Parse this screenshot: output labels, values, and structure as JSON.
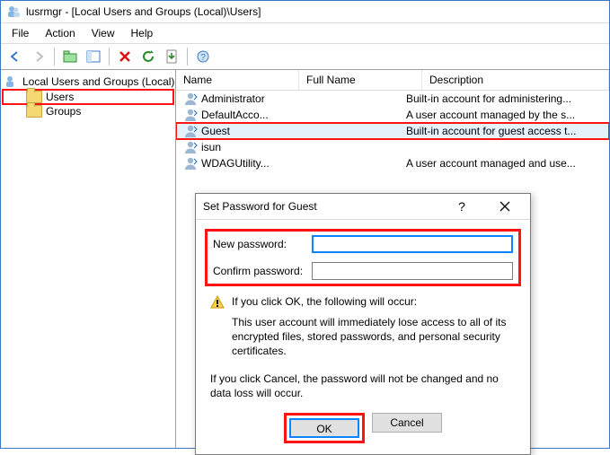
{
  "window": {
    "title": "lusrmgr - [Local Users and Groups (Local)\\Users]"
  },
  "menu": {
    "file": "File",
    "action": "Action",
    "view": "View",
    "help": "Help"
  },
  "tree": {
    "root": "Local Users and Groups (Local)",
    "users": "Users",
    "groups": "Groups"
  },
  "list": {
    "headers": {
      "name": "Name",
      "fullname": "Full Name",
      "description": "Description"
    },
    "rows": [
      {
        "name": "Administrator",
        "fullname": "",
        "description": "Built-in account for administering..."
      },
      {
        "name": "DefaultAcco...",
        "fullname": "",
        "description": "A user account managed by the s..."
      },
      {
        "name": "Guest",
        "fullname": "",
        "description": "Built-in account for guest access t..."
      },
      {
        "name": "isun",
        "fullname": "",
        "description": ""
      },
      {
        "name": "WDAGUtility...",
        "fullname": "",
        "description": "A user account managed and use..."
      }
    ]
  },
  "dialog": {
    "title": "Set Password for Guest",
    "new_label": "New password:",
    "confirm_label": "Confirm password:",
    "new_value": "",
    "confirm_value": "",
    "warn_lead": "If you click OK, the following will occur:",
    "warn_body": "This user account will immediately lose access to all of its encrypted files, stored passwords, and personal security certificates.",
    "cancel_note": "If you click Cancel, the password will not be changed and no data loss will occur.",
    "ok": "OK",
    "cancel": "Cancel"
  }
}
